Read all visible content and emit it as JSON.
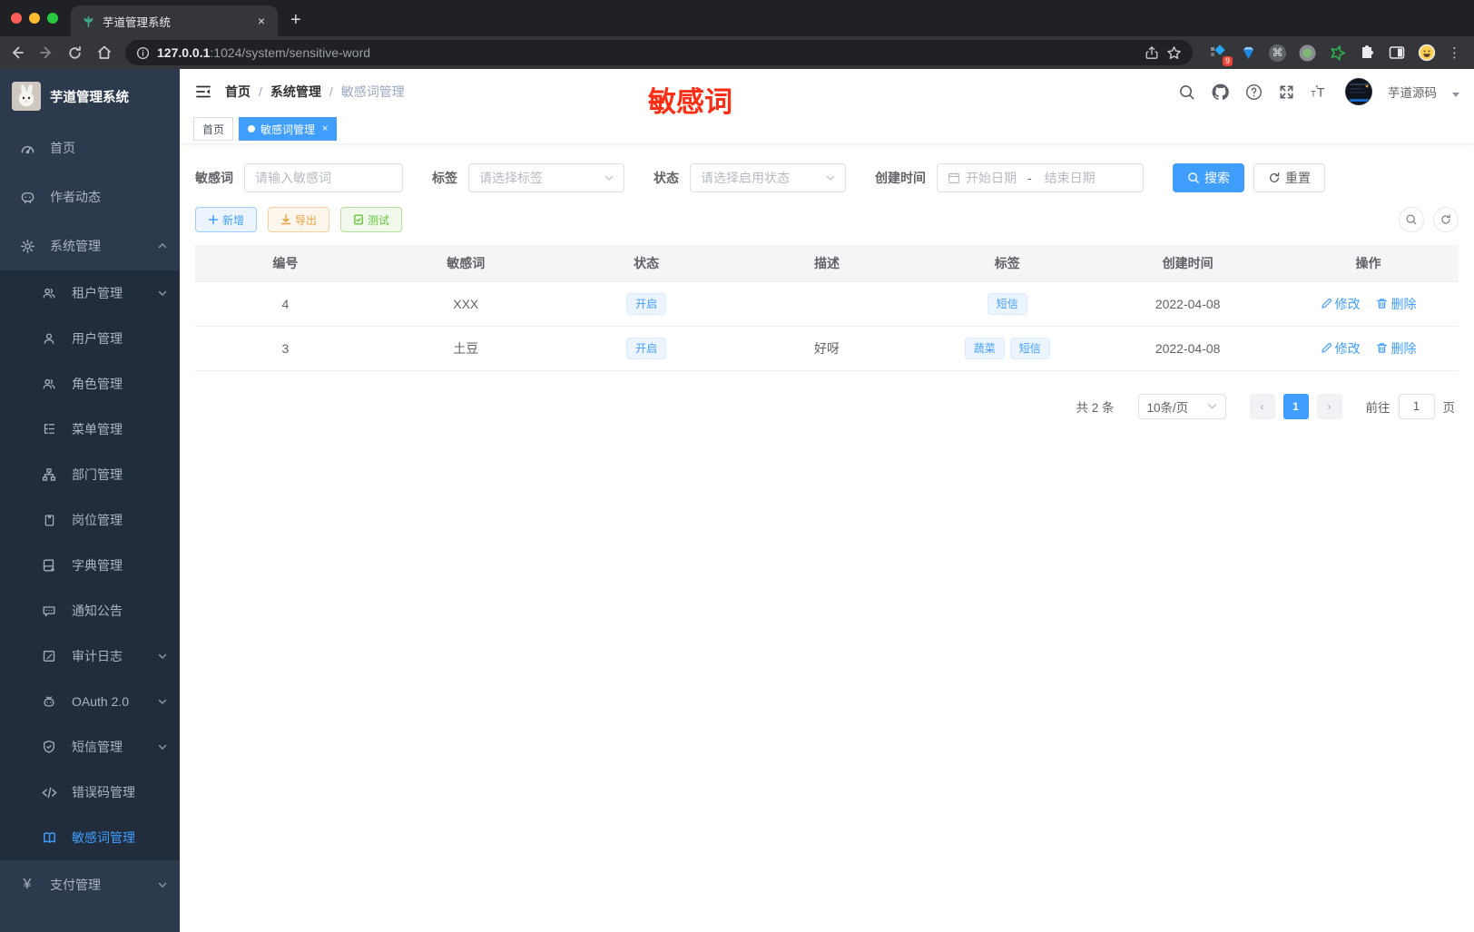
{
  "browser": {
    "tab_title": "芋道管理系统",
    "new_tab": "+",
    "close": "×",
    "url_host": "127.0.0.1",
    "url_rest": ":1024/system/sensitive-word",
    "extension_badge": "9",
    "cmd_glyph": "⌘"
  },
  "sidebar": {
    "app_title": "芋道管理系统",
    "menu": [
      {
        "label": "首页"
      },
      {
        "label": "作者动态"
      },
      {
        "label": "系统管理"
      }
    ],
    "submenu": [
      {
        "label": "租户管理"
      },
      {
        "label": "用户管理"
      },
      {
        "label": "角色管理"
      },
      {
        "label": "菜单管理"
      },
      {
        "label": "部门管理"
      },
      {
        "label": "岗位管理"
      },
      {
        "label": "字典管理"
      },
      {
        "label": "通知公告"
      },
      {
        "label": "审计日志"
      },
      {
        "label": "OAuth 2.0"
      },
      {
        "label": "短信管理"
      },
      {
        "label": "错误码管理"
      },
      {
        "label": "敏感词管理"
      }
    ],
    "bottom": {
      "label": "支付管理"
    }
  },
  "header": {
    "breadcrumb": [
      "首页",
      "系统管理",
      "敏感词管理"
    ],
    "breadcrumb_separator": "/",
    "annotation": "敏感词",
    "username": "芋道源码"
  },
  "view_tabs": [
    {
      "label": "首页"
    },
    {
      "label": "敏感词管理",
      "close": "×"
    }
  ],
  "filters": {
    "keyword": {
      "label": "敏感词",
      "placeholder": "请输入敏感词"
    },
    "tag": {
      "label": "标签",
      "placeholder": "请选择标签"
    },
    "status": {
      "label": "状态",
      "placeholder": "请选择启用状态"
    },
    "created": {
      "label": "创建时间",
      "start_placeholder": "开始日期",
      "separator": "-",
      "end_placeholder": "结束日期"
    },
    "search_label": "搜索",
    "reset_label": "重置"
  },
  "toolbar": {
    "add_label": "新增",
    "export_label": "导出",
    "test_label": "测试"
  },
  "table": {
    "headers": [
      "编号",
      "敏感词",
      "状态",
      "描述",
      "标签",
      "创建时间",
      "操作"
    ],
    "edit_label": "修改",
    "delete_label": "删除",
    "rows": [
      {
        "id": "4",
        "word": "XXX",
        "status": "开启",
        "desc": "",
        "tags": [
          "短信"
        ],
        "created": "2022-04-08"
      },
      {
        "id": "3",
        "word": "土豆",
        "status": "开启",
        "desc": "好呀",
        "tags": [
          "蔬菜",
          "短信"
        ],
        "created": "2022-04-08"
      }
    ]
  },
  "pagination": {
    "total_text": "共 2 条",
    "page_size": "10条/页",
    "prev": "‹",
    "current_page": "1",
    "next": "›",
    "goto_label": "前往",
    "goto_value": "1",
    "page_unit": "页"
  },
  "colors": {
    "accent": "#409eff",
    "warning": "#e6a23c",
    "success": "#67c23a",
    "annotation_red": "#fb2e15",
    "sidebar_bg": "#2d394c",
    "submenu_bg": "#212c3d"
  }
}
